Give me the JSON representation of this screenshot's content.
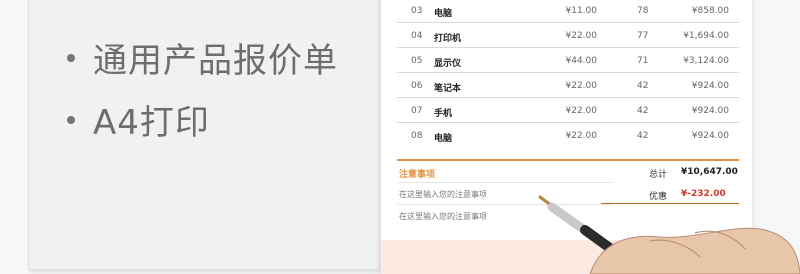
{
  "slide": {
    "bullets": [
      {
        "text": "通用产品报价单"
      },
      {
        "text": "A4打印"
      }
    ]
  },
  "quote": {
    "rows": [
      {
        "no": "03",
        "name": "电脑",
        "price": "¥11.00",
        "qty": "78",
        "total": "¥858.00"
      },
      {
        "no": "04",
        "name": "打印机",
        "price": "¥22.00",
        "qty": "77",
        "total": "¥1,694.00"
      },
      {
        "no": "05",
        "name": "显示仪",
        "price": "¥44.00",
        "qty": "71",
        "total": "¥3,124.00"
      },
      {
        "no": "06",
        "name": "笔记本",
        "price": "¥22.00",
        "qty": "42",
        "total": "¥924.00"
      },
      {
        "no": "07",
        "name": "手机",
        "price": "¥22.00",
        "qty": "42",
        "total": "¥924.00"
      },
      {
        "no": "08",
        "name": "电脑",
        "price": "¥22.00",
        "qty": "42",
        "total": "¥924.00"
      }
    ],
    "notes_title": "注意事项",
    "notes": [
      "在这里输入您的注意事项",
      "在这里输入您的注意事项"
    ],
    "total_label": "总计",
    "total_value": "¥10,647.00",
    "discount_label": "优惠",
    "discount_value": "¥-232.00"
  },
  "colors": {
    "accent_orange": "#e3923d",
    "discount_red": "#d03a2a",
    "band_pink": "#fbe9e2"
  }
}
